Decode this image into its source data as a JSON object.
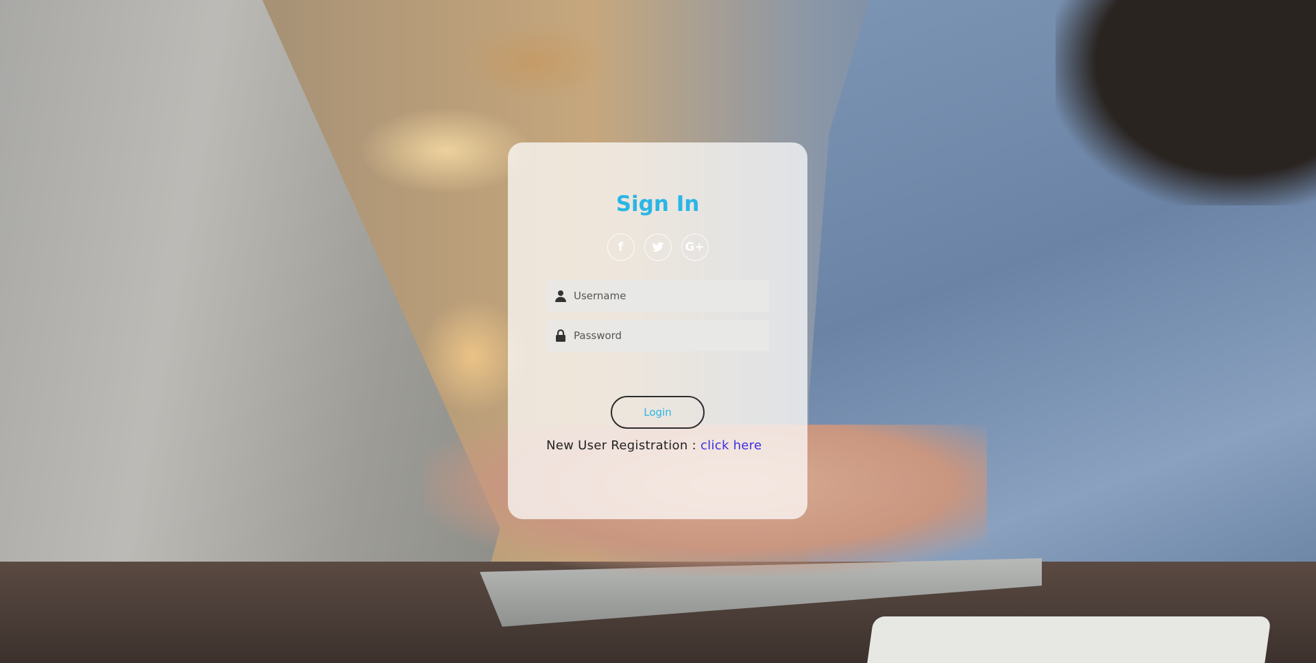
{
  "login_card": {
    "title": "Sign In",
    "social": [
      {
        "icon": "facebook-icon",
        "glyph": "f"
      },
      {
        "icon": "twitter-icon",
        "glyph": "t"
      },
      {
        "icon": "google-plus-icon",
        "glyph": "G+"
      }
    ],
    "username": {
      "placeholder": "Username",
      "value": ""
    },
    "password": {
      "placeholder": "Password",
      "value": ""
    },
    "login_label": "Login",
    "register_text": "New User Registration : ",
    "register_link": "click here"
  },
  "colors": {
    "title": "#29b6e6",
    "link": "#3a2ee0",
    "card_bg": "rgba(255,255,255,0.72)"
  }
}
